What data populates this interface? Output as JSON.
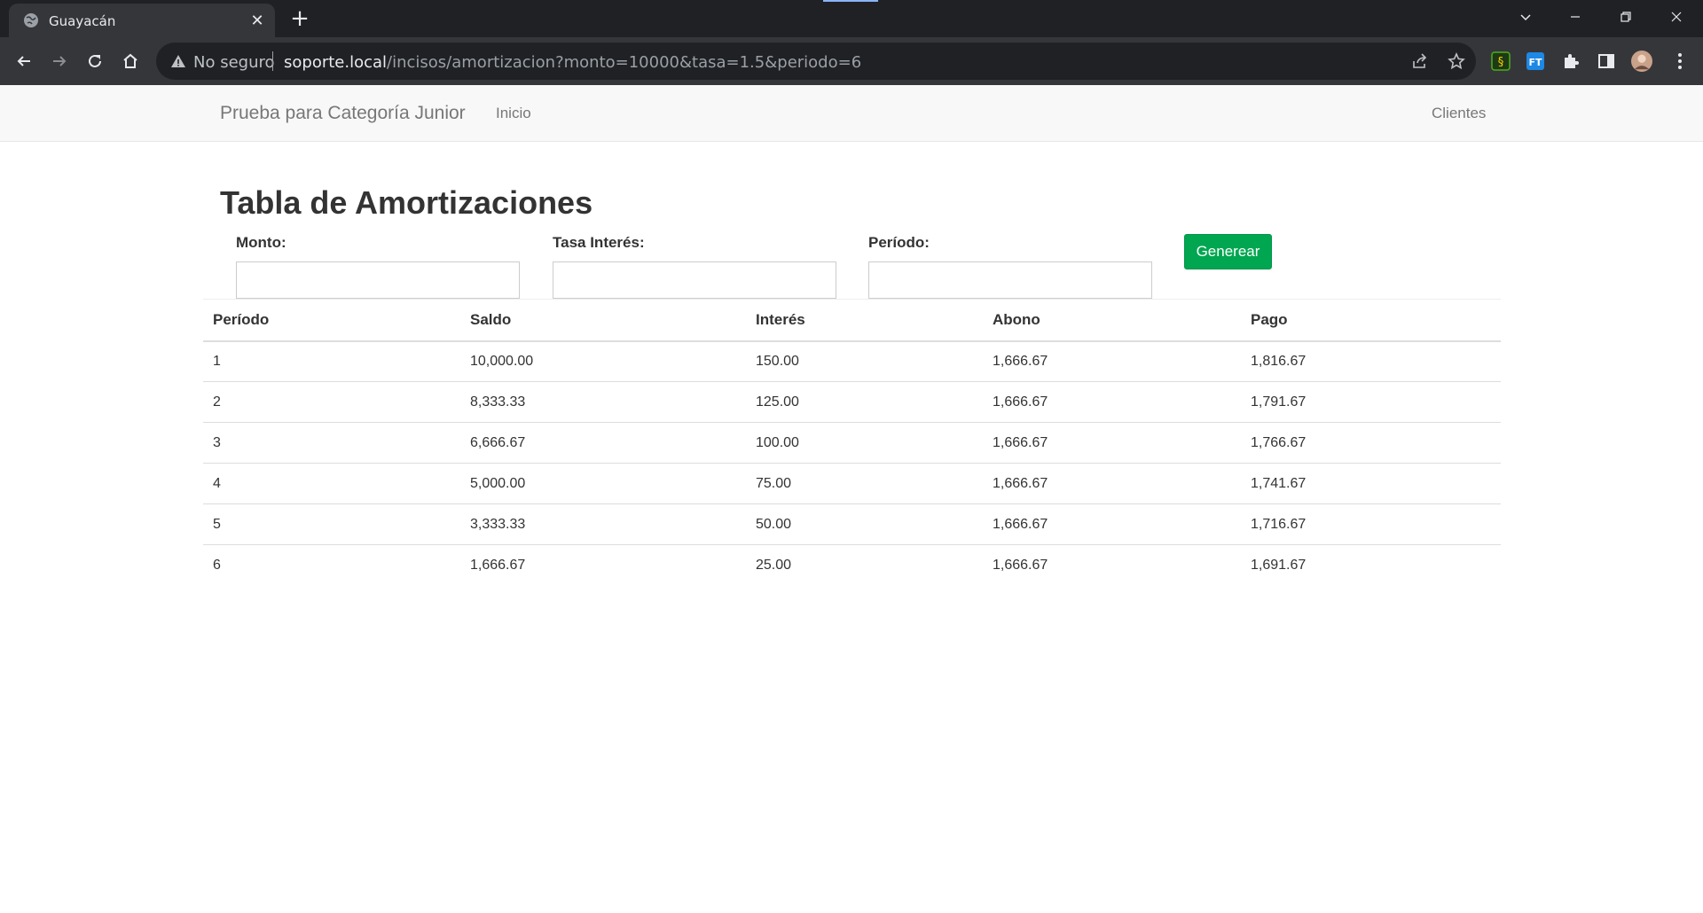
{
  "browser": {
    "tab_title": "Guayacán",
    "security_label": "No seguro",
    "url_host": "soporte.local",
    "url_path": "/incisos/amortizacion?monto=10000&tasa=1.5&periodo=6",
    "icons": [
      "back-icon",
      "forward-icon",
      "reload-icon",
      "home-icon",
      "warning-icon",
      "share-icon",
      "star-icon",
      "extension-icon",
      "sidebar-icon",
      "avatar"
    ]
  },
  "navbar": {
    "brand": "Prueba para Categoría Junior",
    "links": [
      "Inicio",
      "Clientes"
    ]
  },
  "page": {
    "title": "Tabla de Amortizaciones"
  },
  "form": {
    "monto_label": "Monto:",
    "monto_value": "",
    "tasa_label": "Tasa Interés:",
    "tasa_value": "",
    "periodo_label": "Período:",
    "periodo_value": "",
    "submit_label": "Generear",
    "submit_color": "#00a650"
  },
  "table": {
    "headers": [
      "Período",
      "Saldo",
      "Interés",
      "Abono",
      "Pago"
    ],
    "rows": [
      [
        "1",
        "10,000.00",
        "150.00",
        "1,666.67",
        "1,816.67"
      ],
      [
        "2",
        "8,333.33",
        "125.00",
        "1,666.67",
        "1,791.67"
      ],
      [
        "3",
        "6,666.67",
        "100.00",
        "1,666.67",
        "1,766.67"
      ],
      [
        "4",
        "5,000.00",
        "75.00",
        "1,666.67",
        "1,741.67"
      ],
      [
        "5",
        "3,333.33",
        "50.00",
        "1,666.67",
        "1,716.67"
      ],
      [
        "6",
        "1,666.67",
        "25.00",
        "1,666.67",
        "1,691.67"
      ]
    ]
  }
}
